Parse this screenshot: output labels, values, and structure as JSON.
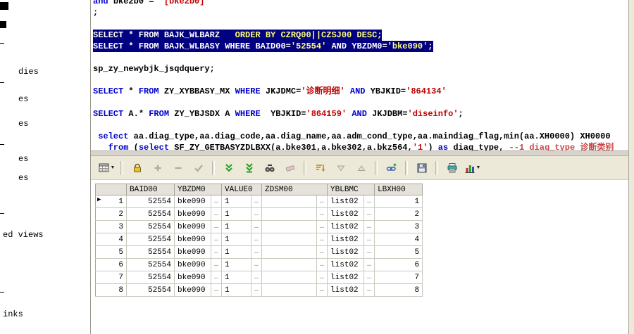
{
  "colors": {
    "selection_bg": "#000080",
    "selection_accent": "#ffff78",
    "keyword": "#0000cc",
    "string": "#c00000",
    "comment": "#cc4444",
    "cell_green": "#ecf4e0"
  },
  "sidebar": {
    "items": [
      {
        "label": "dies"
      },
      {
        "label": "es"
      },
      {
        "label": "es"
      },
      {
        "label": "es"
      },
      {
        "label": "es"
      },
      {
        "label": "ed views"
      },
      {
        "label": "inks"
      }
    ]
  },
  "editor": {
    "lines": [
      {
        "selected": false,
        "segs": [
          {
            "t": "and ",
            "c": "kw"
          },
          {
            "t": "bke2b0 = ",
            "c": "id"
          },
          {
            "t": "'[bke2b0]'",
            "c": "str"
          }
        ]
      },
      {
        "selected": false,
        "segs": [
          {
            "t": ";",
            "c": "id"
          }
        ]
      },
      {
        "selected": false,
        "segs": []
      },
      {
        "selected": true,
        "segs": [
          {
            "t": "SELECT * FROM BAJK_WLBARZ   ",
            "c": "selw"
          },
          {
            "t": "ORDER BY CZRQ00||CZSJ00 DESC;",
            "c": "sely"
          }
        ]
      },
      {
        "selected": true,
        "segs": [
          {
            "t": "SELECT * FROM BAJK_WLBASY WHERE BAID00=",
            "c": "selw"
          },
          {
            "t": "'52554'",
            "c": "sely"
          },
          {
            "t": " AND YBZDM0=",
            "c": "selw"
          },
          {
            "t": "'bke090'",
            "c": "sely"
          },
          {
            "t": ";",
            "c": "selw"
          }
        ]
      },
      {
        "selected": false,
        "segs": []
      },
      {
        "selected": false,
        "segs": [
          {
            "t": "sp_zy_newybjk_jsqdquery;",
            "c": "id"
          }
        ]
      },
      {
        "selected": false,
        "segs": []
      },
      {
        "selected": false,
        "segs": [
          {
            "t": "SELECT",
            "c": "kw"
          },
          {
            "t": " * ",
            "c": "id"
          },
          {
            "t": "FROM",
            "c": "kw"
          },
          {
            "t": " ZY_XYBBASY_MX ",
            "c": "id"
          },
          {
            "t": "WHERE",
            "c": "kw"
          },
          {
            "t": " JKJDMC=",
            "c": "id"
          },
          {
            "t": "'诊断明细'",
            "c": "str"
          },
          {
            "t": " ",
            "c": "id"
          },
          {
            "t": "AND",
            "c": "kw"
          },
          {
            "t": " YBJKID=",
            "c": "id"
          },
          {
            "t": "'864134'",
            "c": "str"
          }
        ]
      },
      {
        "selected": false,
        "segs": []
      },
      {
        "selected": false,
        "segs": [
          {
            "t": "SELECT",
            "c": "kw"
          },
          {
            "t": " A.* ",
            "c": "id"
          },
          {
            "t": "FROM",
            "c": "kw"
          },
          {
            "t": " ZY_YBJSDX A ",
            "c": "id"
          },
          {
            "t": "WHERE",
            "c": "kw"
          },
          {
            "t": "  YBJKID=",
            "c": "id"
          },
          {
            "t": "'864159'",
            "c": "str"
          },
          {
            "t": " ",
            "c": "id"
          },
          {
            "t": "AND",
            "c": "kw"
          },
          {
            "t": " JKJDBM=",
            "c": "id"
          },
          {
            "t": "'diseinfo'",
            "c": "str"
          },
          {
            "t": ";",
            "c": "id"
          }
        ]
      },
      {
        "selected": false,
        "segs": []
      },
      {
        "selected": false,
        "segs": [
          {
            "t": " ",
            "c": "id"
          },
          {
            "t": "select",
            "c": "kw"
          },
          {
            "t": " aa.diag_type,aa.diag_code,aa.diag_name,aa.adm_cond_type,aa.maindiag_flag,min(aa.XH0000) XH0000",
            "c": "id"
          }
        ]
      },
      {
        "selected": false,
        "segs": [
          {
            "t": "   ",
            "c": "id"
          },
          {
            "t": "from",
            "c": "kw"
          },
          {
            "t": " (",
            "c": "id"
          },
          {
            "t": "select",
            "c": "kw"
          },
          {
            "t": " SF_ZY_GETBASYZDLBXX(a.bke301,a.bke302,a.bkz564,",
            "c": "id"
          },
          {
            "t": "'1'",
            "c": "str"
          },
          {
            "t": ") ",
            "c": "id"
          },
          {
            "t": "as",
            "c": "kw"
          },
          {
            "t": " diag_type, ",
            "c": "id"
          },
          {
            "t": "--1 diag_type 诊断类别",
            "c": "com"
          }
        ]
      }
    ]
  },
  "toolbar": {
    "buttons": [
      {
        "name": "grid-mode-button",
        "icon": "grid",
        "dropdown": true
      },
      {
        "name": "lock-record-button",
        "icon": "lock",
        "sep": true
      },
      {
        "name": "insert-record-button",
        "icon": "plus",
        "disabled": true
      },
      {
        "name": "delete-record-button",
        "icon": "minus",
        "disabled": true
      },
      {
        "name": "post-changes-button",
        "icon": "check",
        "disabled": true
      },
      {
        "name": "fetch-next-page-button",
        "icon": "chevrons",
        "sep": true
      },
      {
        "name": "fetch-last-page-button",
        "icon": "chevrons-end"
      },
      {
        "name": "find-button",
        "icon": "binoculars"
      },
      {
        "name": "clear-results-button",
        "icon": "eraser",
        "disabled": true
      },
      {
        "name": "sort-button",
        "icon": "sort",
        "sep": true
      },
      {
        "name": "filter-descending-button",
        "icon": "tri-down",
        "disabled": true
      },
      {
        "name": "filter-ascending-button",
        "icon": "tri-up",
        "disabled": true
      },
      {
        "name": "linked-query-button",
        "icon": "link",
        "sep": true
      },
      {
        "name": "save-results-button",
        "icon": "floppy",
        "sep": true
      },
      {
        "name": "print-button",
        "icon": "printer",
        "sep": true
      },
      {
        "name": "chart-button",
        "icon": "chart",
        "dropdown": true
      }
    ]
  },
  "grid": {
    "ellipsis": "…",
    "columns": [
      {
        "label": "BAID00"
      },
      {
        "label": "YBZDM0"
      },
      {
        "label": "VALUE0"
      },
      {
        "label": "ZDSM00"
      },
      {
        "label": "YBLBMC"
      },
      {
        "label": "LBXH00"
      }
    ],
    "rows": [
      {
        "num": "1",
        "baid00": "52554",
        "ybzdm0": "bke090",
        "value0": "1",
        "zdsm00": "",
        "yblbmc": "list02",
        "lbxh00": "1",
        "current": true
      },
      {
        "num": "2",
        "baid00": "52554",
        "ybzdm0": "bke090",
        "value0": "1",
        "zdsm00": "",
        "yblbmc": "list02",
        "lbxh00": "2",
        "current": false
      },
      {
        "num": "3",
        "baid00": "52554",
        "ybzdm0": "bke090",
        "value0": "1",
        "zdsm00": "",
        "yblbmc": "list02",
        "lbxh00": "3",
        "current": false
      },
      {
        "num": "4",
        "baid00": "52554",
        "ybzdm0": "bke090",
        "value0": "1",
        "zdsm00": "",
        "yblbmc": "list02",
        "lbxh00": "4",
        "current": false
      },
      {
        "num": "5",
        "baid00": "52554",
        "ybzdm0": "bke090",
        "value0": "1",
        "zdsm00": "",
        "yblbmc": "list02",
        "lbxh00": "5",
        "current": false
      },
      {
        "num": "6",
        "baid00": "52554",
        "ybzdm0": "bke090",
        "value0": "1",
        "zdsm00": "",
        "yblbmc": "list02",
        "lbxh00": "6",
        "current": false
      },
      {
        "num": "7",
        "baid00": "52554",
        "ybzdm0": "bke090",
        "value0": "1",
        "zdsm00": "",
        "yblbmc": "list02",
        "lbxh00": "7",
        "current": false
      },
      {
        "num": "8",
        "baid00": "52554",
        "ybzdm0": "bke090",
        "value0": "1",
        "zdsm00": "",
        "yblbmc": "list02",
        "lbxh00": "8",
        "current": false
      }
    ]
  }
}
